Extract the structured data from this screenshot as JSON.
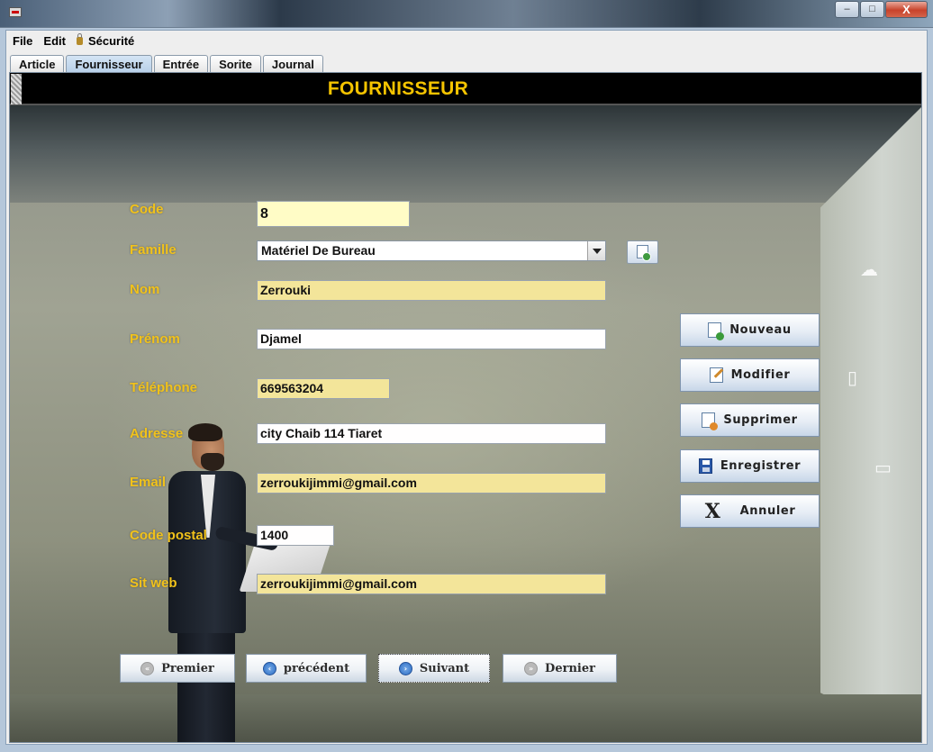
{
  "window": {
    "minimize_glyph": "–",
    "maximize_glyph": "□",
    "close_glyph": "X"
  },
  "menu": {
    "items": [
      "File",
      "Edit",
      "Sécurité"
    ]
  },
  "tabs": [
    "Article",
    "Fournisseur",
    "Entrée",
    "Sorite",
    "Journal"
  ],
  "active_tab": "Fournisseur",
  "header": {
    "title": "FOURNISSEUR"
  },
  "form": {
    "labels": {
      "code": "Code",
      "famille": "Famille",
      "nom": "Nom",
      "prenom": "Prénom",
      "telephone": "Téléphone",
      "adresse": "Adresse",
      "email": "Email",
      "code_postal": "Code postal",
      "site_web": "Sit web"
    },
    "values": {
      "code": "8",
      "famille": "Matériel De Bureau",
      "nom": "Zerrouki",
      "prenom": "Djamel",
      "telephone": "669563204",
      "adresse": "city Chaib 114 Tiaret",
      "email": "zerroukijimmi@gmail.com",
      "code_postal": "1400",
      "site_web": "zerroukijimmi@gmail.com"
    }
  },
  "actions": {
    "nouveau": "Nouveau",
    "modifier": "Modifier",
    "supprimer": "Supprimer",
    "enregistrer": "Enregistrer",
    "annuler": "Annuler",
    "annuler_glyph": "X"
  },
  "navigation": {
    "premier": "Premier",
    "precedent": "précédent",
    "suivant": "Suivant",
    "dernier": "Dernier"
  },
  "colors": {
    "label": "#f1c21b",
    "header_title": "#f5c400",
    "field_highlight": "#f3e59a"
  }
}
